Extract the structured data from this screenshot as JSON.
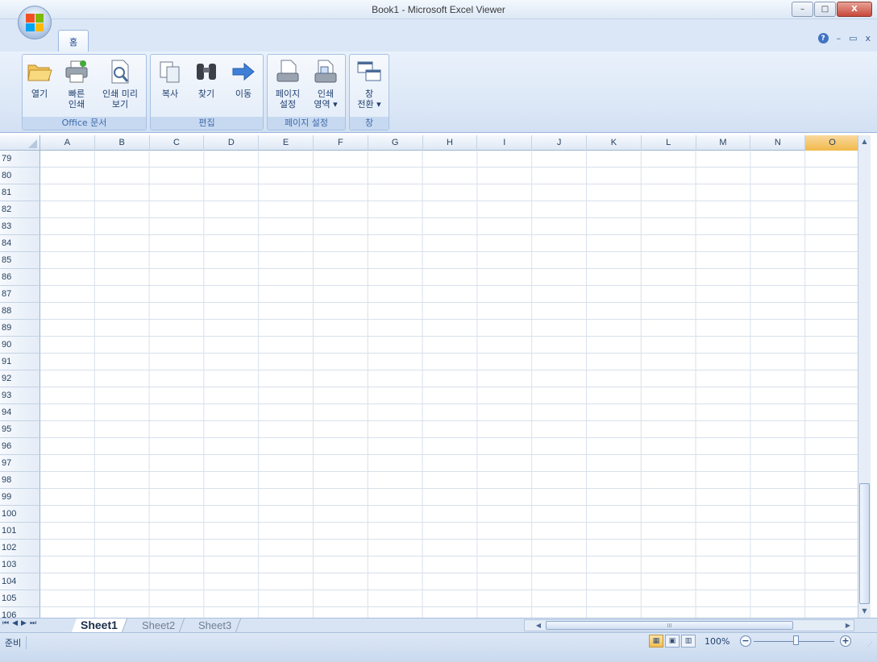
{
  "window": {
    "title": "Book1 - Microsoft Excel Viewer",
    "minimize": "–",
    "maximize": "□",
    "close": "X"
  },
  "ribbon": {
    "tabs": [
      {
        "label": "홈",
        "active": true
      }
    ],
    "help": "?",
    "mdi_minimize": "–",
    "mdi_restore": "▭",
    "mdi_close": "x",
    "groups": [
      {
        "label": "Office 문서",
        "buttons": [
          {
            "label_line1": "열기",
            "label_line2": "",
            "icon": "folder-open-icon"
          },
          {
            "label_line1": "빠른",
            "label_line2": "인쇄",
            "icon": "printer-icon"
          },
          {
            "label_line1": "인쇄 미리",
            "label_line2": "보기",
            "icon": "print-preview-icon"
          }
        ]
      },
      {
        "label": "편집",
        "buttons": [
          {
            "label_line1": "복사",
            "label_line2": "",
            "icon": "copy-icon"
          },
          {
            "label_line1": "찾기",
            "label_line2": "",
            "icon": "binoculars-icon"
          },
          {
            "label_line1": "이동",
            "label_line2": "",
            "icon": "arrow-right-icon"
          }
        ]
      },
      {
        "label": "페이지 설정",
        "buttons": [
          {
            "label_line1": "페이지",
            "label_line2": "설정",
            "icon": "page-setup-icon"
          },
          {
            "label_line1": "인쇄",
            "label_line2": "영역 ▾",
            "icon": "print-area-icon"
          }
        ]
      },
      {
        "label": "창",
        "buttons": [
          {
            "label_line1": "창",
            "label_line2": "전환 ▾",
            "icon": "switch-windows-icon"
          }
        ]
      }
    ]
  },
  "sheet": {
    "columns": [
      "A",
      "B",
      "C",
      "D",
      "E",
      "F",
      "G",
      "H",
      "I",
      "J",
      "K",
      "L",
      "M",
      "N",
      "O"
    ],
    "selected_column": "O",
    "rows": [
      "79",
      "80",
      "81",
      "82",
      "83",
      "84",
      "85",
      "86",
      "87",
      "88",
      "89",
      "90",
      "91",
      "92",
      "93",
      "94",
      "95",
      "96",
      "97",
      "98",
      "99",
      "100",
      "101",
      "102",
      "103",
      "104",
      "105",
      "106"
    ]
  },
  "sheet_tabs": {
    "nav": [
      "⏮",
      "◀",
      "▶",
      "⏭"
    ],
    "tabs": [
      "Sheet1",
      "Sheet2",
      "Sheet3"
    ],
    "active": "Sheet1"
  },
  "status": {
    "text": "준비",
    "zoom": "100%",
    "zoom_minus": "−",
    "zoom_plus": "+"
  },
  "colors": {
    "accent": "#15428b",
    "ribbon_bg": "#dbe7f6",
    "selected_header": "#f1b94a",
    "gridline": "#d7e0ec"
  }
}
